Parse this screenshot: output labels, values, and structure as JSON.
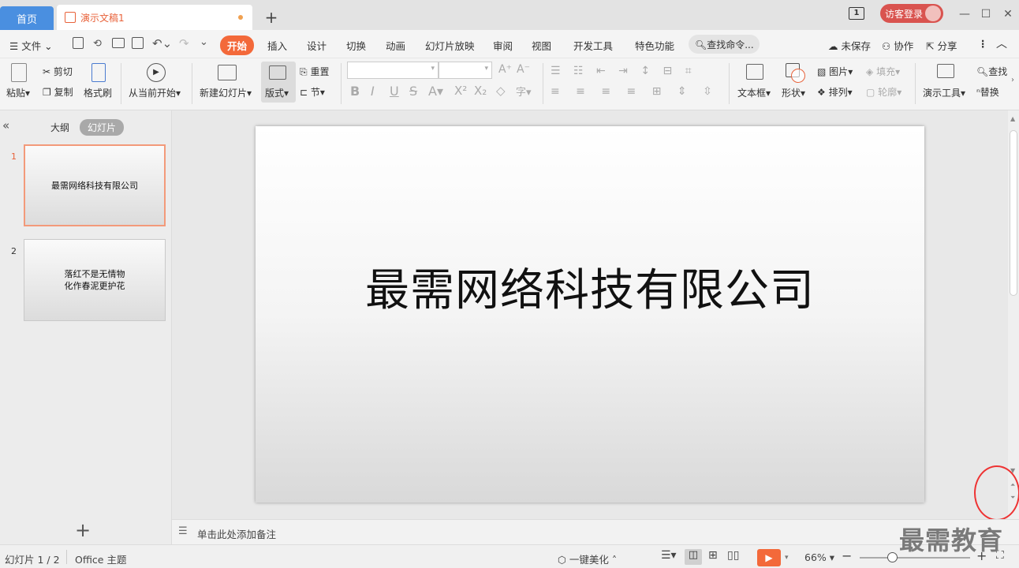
{
  "titlebar": {
    "home_tab": "首页",
    "doc_tab": "演示文稿1",
    "page_indicator": "1",
    "guest_login": "访客登录"
  },
  "menu": {
    "file": "文件",
    "items": [
      "开始",
      "插入",
      "设计",
      "切换",
      "动画",
      "幻灯片放映",
      "审阅",
      "视图",
      "开发工具",
      "特色功能"
    ],
    "active": "开始",
    "search_placeholder": "查找命令...",
    "unsaved": "未保存",
    "collab": "协作",
    "share": "分享"
  },
  "ribbon": {
    "paste": "粘贴",
    "cut": "剪切",
    "copy": "复制",
    "format_painter": "格式刷",
    "from_current": "从当前开始",
    "new_slide": "新建幻灯片",
    "layout": "版式",
    "reset": "重置",
    "section": "节",
    "textbox": "文本框",
    "shape": "形状",
    "picture": "图片",
    "arrange": "排列",
    "fill": "填充",
    "outline": "轮廓",
    "present_tools": "演示工具",
    "find": "查找",
    "replace": "替换"
  },
  "panel": {
    "outline_tab": "大纲",
    "slides_tab": "幻灯片",
    "slides": [
      {
        "num": "1",
        "lines": [
          "最需网络科技有限公司"
        ]
      },
      {
        "num": "2",
        "lines": [
          "落红不是无情物",
          "化作春泥更护花"
        ]
      }
    ]
  },
  "slide": {
    "title": "最需网络科技有限公司"
  },
  "notes": {
    "placeholder": "单击此处添加备注"
  },
  "status": {
    "slide_count": "幻灯片 1 / 2",
    "theme": "Office 主题",
    "beautify": "一键美化",
    "zoom": "66%"
  },
  "watermark": "最需教育",
  "colors": {
    "accent": "#f3693a",
    "home_tab": "#4a8fe0",
    "guest": "#d9534f"
  }
}
